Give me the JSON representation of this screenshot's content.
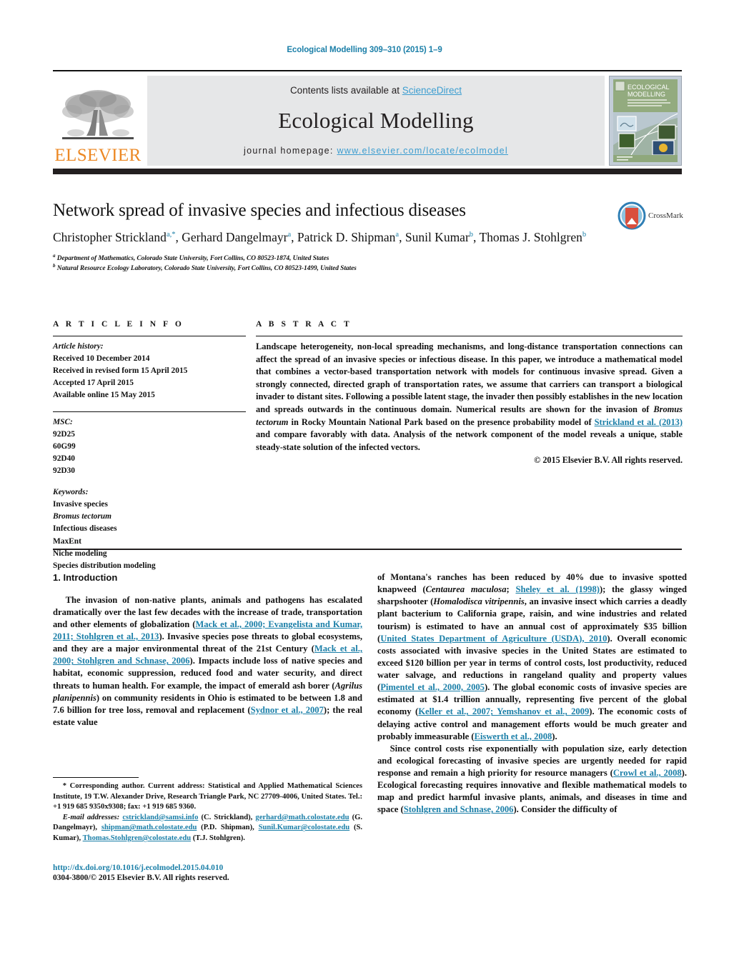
{
  "running_head": "Ecological Modelling 309–310 (2015) 1–9",
  "masthead": {
    "publisher": "ELSEVIER",
    "contents_prefix": "Contents lists available at ",
    "contents_link": "ScienceDirect",
    "journal_title": "Ecological Modelling",
    "homepage_prefix": "journal homepage: ",
    "homepage_url": "www.elsevier.com/locate/ecolmodel",
    "cover_title_line1": "ECOLOGICAL",
    "cover_title_line2": "MODELLING",
    "logo_icon": "elsevier-tree-icon",
    "cover_icon": "journal-cover-thumbnail"
  },
  "crossmark": {
    "label": "CrossMark",
    "icon": "crossmark-shield-icon"
  },
  "title_block": {
    "title": "Network spread of invasive species and infectious diseases",
    "authors": [
      {
        "name": "Christopher Strickland",
        "marks": "a,*"
      },
      {
        "name": "Gerhard Dangelmayr",
        "marks": "a"
      },
      {
        "name": "Patrick D. Shipman",
        "marks": "a"
      },
      {
        "name": "Sunil Kumar",
        "marks": "b"
      },
      {
        "name": "Thomas J. Stohlgren",
        "marks": "b"
      }
    ],
    "affiliations": [
      {
        "mark": "a",
        "text": "Department of Mathematics, Colorado State University, Fort Collins, CO 80523-1874, United States"
      },
      {
        "mark": "b",
        "text": "Natural Resource Ecology Laboratory, Colorado State University, Fort Collins, CO 80523-1499, United States"
      }
    ]
  },
  "article_info": {
    "heading": "A R T I C L E   I N F O",
    "history_label": "Article history:",
    "history": [
      "Received 10 December 2014",
      "Received in revised form 15 April 2015",
      "Accepted 17 April 2015",
      "Available online 15 May 2015"
    ],
    "msc_label": "MSC:",
    "msc": [
      "92D25",
      "60G99",
      "92D40",
      "92D30"
    ],
    "keywords_label": "Keywords:",
    "keywords": [
      {
        "text": "Invasive species",
        "italic": false
      },
      {
        "text": "Bromus tectorum",
        "italic": true
      },
      {
        "text": "Infectious diseases",
        "italic": false
      },
      {
        "text": "MaxEnt",
        "italic": false
      },
      {
        "text": "Niche modeling",
        "italic": false
      },
      {
        "text": "Species distribution modeling",
        "italic": false
      }
    ]
  },
  "abstract": {
    "heading": "A B S T R A C T",
    "part1": "Landscape heterogeneity, non-local spreading mechanisms, and long-distance transportation connections can affect the spread of an invasive species or infectious disease. In this paper, we introduce a mathematical model that combines a vector-based transportation network with models for continuous invasive spread. Given a strongly connected, directed graph of transportation rates, we assume that carriers can transport a biological invader to distant sites. Following a possible latent stage, the invader then possibly establishes in the new location and spreads outwards in the continuous domain. Numerical results are shown for the invasion of ",
    "species_italic": "Bromus tectorum",
    "part2": " in Rocky Mountain National Park based on the presence probability model of ",
    "citation": "Strickland et al. (2013)",
    "part3": " and compare favorably with data. Analysis of the network component of the model reveals a unique, stable steady-state solution of the infected vectors.",
    "copyright": "© 2015 Elsevier B.V. All rights reserved."
  },
  "body": {
    "section_heading": "1. Introduction",
    "left_column": {
      "p1_a": "The invasion of non-native plants, animals and pathogens has escalated dramatically over the last few decades with the increase of trade, transportation and other elements of globalization (",
      "p1_cite1": "Mack et al., 2000; Evangelista and Kumar, 2011; Stohlgren et al., 2013",
      "p1_b": "). Invasive species pose threats to global ecosystems, and they are a major environmental threat of the 21st Century (",
      "p1_cite2": "Mack et al., 2000; Stohlgren and Schnase, 2006",
      "p1_c": "). Impacts include loss of native species and habitat, economic suppression, reduced food and water security, and direct threats to human health. For example, the impact of emerald ash borer (",
      "p1_species": "Agrilus planipennis",
      "p1_d": ") on community residents in Ohio is estimated to be between 1.8 and 7.6 billion for tree loss, removal and replacement (",
      "p1_cite3": "Sydnor et al., 2007",
      "p1_e": "); the real estate value"
    },
    "right_column": {
      "p1_f": "of Montana's ranches has been reduced by 40% due to invasive spotted knapweed (",
      "p1_species2": "Centaurea maculosa",
      "p1_g": "; ",
      "p1_cite4": "Sheley et al. (1998)",
      "p1_h": "); the glassy winged sharpshooter (",
      "p1_species3": "Homalodisca vitripennis",
      "p1_i": ", an invasive insect which carries a deadly plant bacterium to California grape, raisin, and wine industries and related tourism) is estimated to have an annual cost of approximately $35 billion (",
      "p1_cite5": "United States Department of Agriculture (USDA), 2010",
      "p1_j": "). Overall economic costs associated with invasive species in the United States are estimated to exceed $120 billion per year in terms of control costs, lost productivity, reduced water salvage, and reductions in rangeland quality and property values (",
      "p1_cite6": "Pimentel et al., 2000, 2005",
      "p1_k": "). The global economic costs of invasive species are estimated at $1.4 trillion annually, representing five percent of the global economy (",
      "p1_cite7": "Keller et al., 2007; Yemshanov et al., 2009",
      "p1_l": "). The economic costs of delaying active control and management efforts would be much greater and probably immeasurable (",
      "p1_cite8": "Eiswerth et al., 2008",
      "p1_m": ").",
      "p2_a": "Since control costs rise exponentially with population size, early detection and ecological forecasting of invasive species are urgently needed for rapid response and remain a high priority for resource managers (",
      "p2_cite1": "Crowl et al., 2008",
      "p2_b": "). Ecological forecasting requires innovative and flexible mathematical models to map and predict harmful invasive plants, animals, and diseases in time and space (",
      "p2_cite2": "Stohlgren and Schnase, 2006",
      "p2_c": "). Consider the difficulty of"
    }
  },
  "footnote": {
    "corresponding_marker": "*",
    "corresponding_text": " Corresponding author. Current address: Statistical and Applied Mathematical Sciences Institute, 19 T.W. Alexander Drive, Research Triangle Park, NC 27709-4006, United States. Tel.: +1 919 685 9350x9308; fax: +1 919 685 9360.",
    "email_label": "E-mail addresses:",
    "emails": [
      {
        "address": "cstrickland@samsi.info",
        "owner": " (C. Strickland),"
      },
      {
        "address": "gerhard@math.colostate.edu",
        "owner": " (G. Dangelmayr),"
      },
      {
        "address": "shipman@math.colostate.edu",
        "owner": " (P.D. Shipman),"
      },
      {
        "address": "Sunil.Kumar@colostate.edu",
        "owner": " (S. Kumar),"
      },
      {
        "address": "Thomas.Stohlgren@colostate.edu",
        "owner": " (T.J. Stohlgren)."
      }
    ]
  },
  "doi_block": {
    "doi": "http://dx.doi.org/10.1016/j.ecolmodel.2015.04.010",
    "issn": "0304-3800/© 2015 Elsevier B.V. All rights reserved."
  },
  "colors": {
    "link_blue": "#1b7fa8",
    "sd_blue": "#3c9dd0",
    "elsevier_orange": "#ec8824",
    "band_gray": "#e6e7e8",
    "rule_dark": "#231f20"
  }
}
